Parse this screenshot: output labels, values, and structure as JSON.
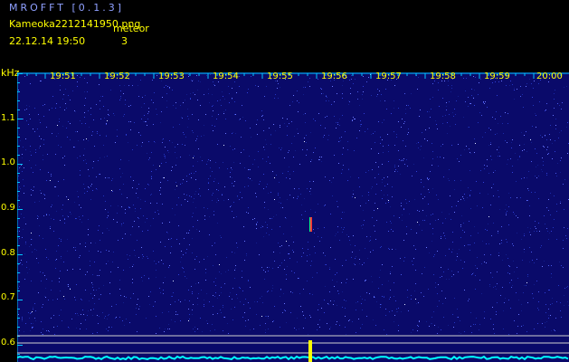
{
  "header": {
    "app_title": "MROFFT [0.1.3]",
    "filename": "Kameoka2212141950.png",
    "datetime": "22.12.14  19:50",
    "meteor_label": "meteor",
    "meteor_count": "3"
  },
  "axes": {
    "y_unit": "kHz",
    "y_ticks": [
      "1.1",
      "1.0",
      "0.9",
      "0.8",
      "0.7",
      "0.6"
    ],
    "x_ticks": [
      "19:51",
      "19:52",
      "19:53",
      "19:54",
      "19:55",
      "19:56",
      "19:57",
      "19:58",
      "19:59",
      "20:00"
    ]
  },
  "colors": {
    "background": "#000000",
    "spectrogram": "#0a0a6a",
    "text": "#ffff00",
    "title": "#8fa0ff",
    "axis": "#00c8ff",
    "baseline": "#00ffff",
    "meteor_echo": "#ff3a3a",
    "meteor_spike": "#ffff00"
  }
}
